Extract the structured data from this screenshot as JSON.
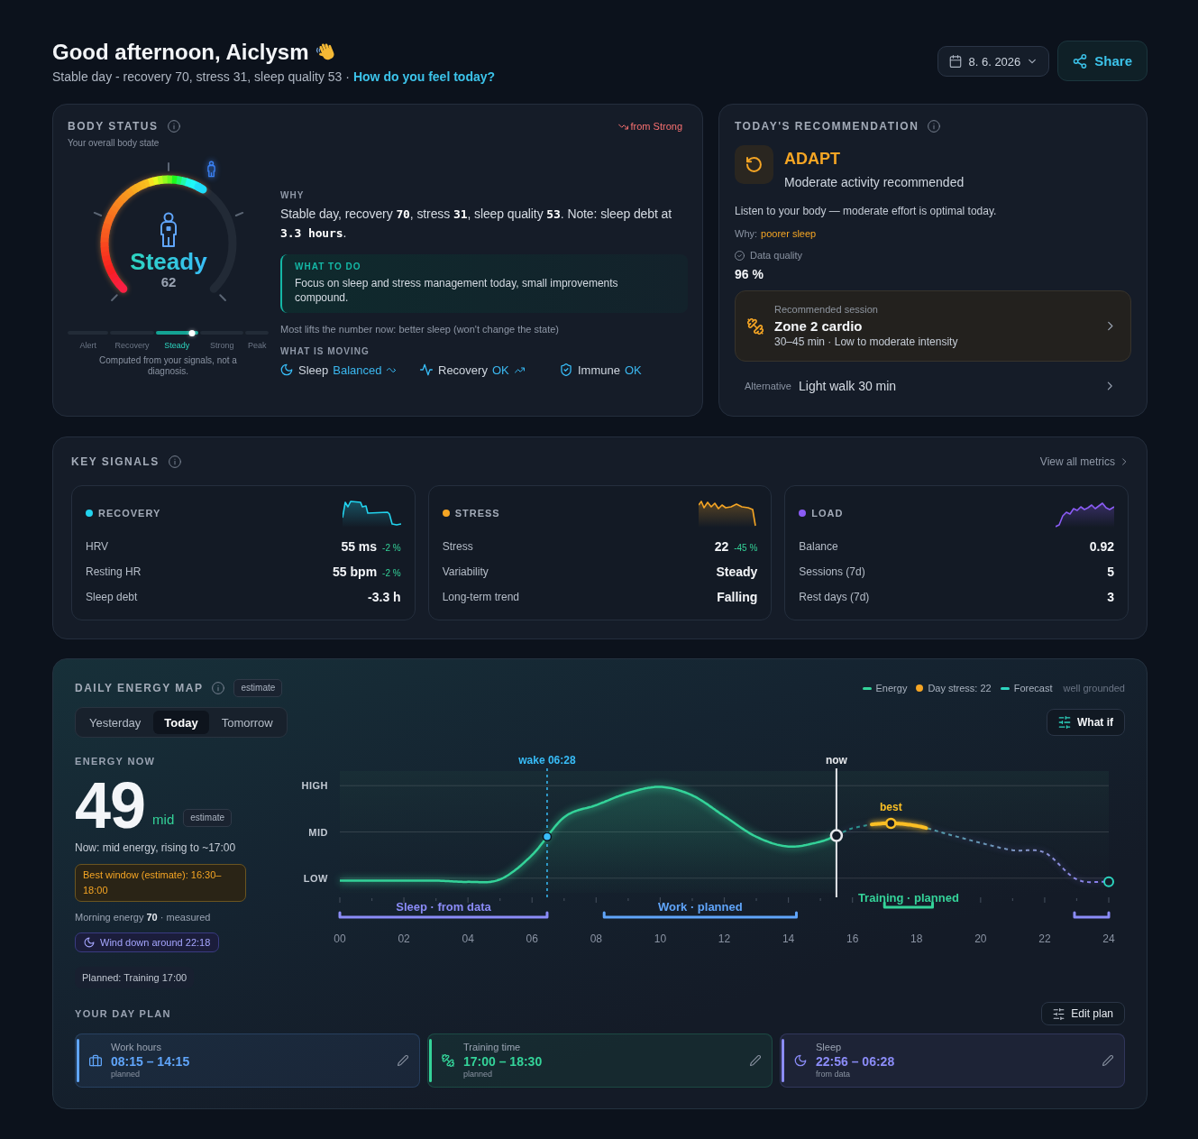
{
  "header": {
    "greeting": "Good afternoon, Aiclysm",
    "summary": "Stable day - recovery 70, stress 31, sleep quality 53 ·",
    "link": "How do you feel today?",
    "date": "8. 6. 2026",
    "share": "Share"
  },
  "body_status": {
    "title": "BODY STATUS",
    "subtitle": "Your overall body state",
    "change": {
      "label": "from Strong"
    },
    "gauge": {
      "state": "Steady",
      "score": "62",
      "level": 0.62
    },
    "scale": [
      {
        "label": "Alert",
        "selected": false
      },
      {
        "label": "Recovery",
        "selected": false
      },
      {
        "label": "Steady",
        "selected": true
      },
      {
        "label": "Strong",
        "selected": false
      },
      {
        "label": "Peak",
        "selected": false
      }
    ],
    "disclaimer": "Computed from your signals, not a diagnosis.",
    "why_title": "WHY",
    "why": "Stable day, recovery **70**, stress **31**, sleep quality **53**. Note: sleep debt at **3.3 hours**.",
    "todo": {
      "title": "WHAT TO DO",
      "text": "Focus on sleep and stress management today, small improvements compound."
    },
    "lift_note": "Most lifts the number now: better sleep (won't change the state)",
    "moving_title": "WHAT IS MOVING",
    "moving": [
      {
        "kind": "sleep",
        "label": "Sleep",
        "status": "Balanced",
        "trend": {
          "kind": "sideways"
        }
      },
      {
        "kind": "recovery",
        "label": "Recovery",
        "status": "OK",
        "trend": {
          "kind": "up"
        }
      },
      {
        "kind": "immune",
        "label": "Immune",
        "status": "OK"
      }
    ]
  },
  "recommendation": {
    "title": "TODAY'S RECOMMENDATION",
    "mode": "ADAPT",
    "headline": "Moderate activity recommended",
    "advice": "Listen to your body — moderate effort is optimal today.",
    "why_label": "Why:",
    "why_value": "poorer sleep",
    "quality_label": "Data quality",
    "quality_value": "96 %",
    "session": {
      "caption": "Recommended session",
      "name": "Zone 2 cardio",
      "details": "30–45 min · Low to moderate intensity"
    },
    "alternative": {
      "caption": "Alternative",
      "name": "Light walk 30 min"
    }
  },
  "key_signals": {
    "title": "KEY SIGNALS",
    "link": "View all metrics",
    "cards": [
      {
        "title": "RECOVERY",
        "color": "#22d3ee",
        "rows": [
          {
            "label": "HRV",
            "value": "55 ms",
            "delta": "-2 %"
          },
          {
            "label": "Resting HR",
            "value": "55 bpm",
            "delta": "-2 %"
          },
          {
            "label": "Sleep debt",
            "value": "-3.3 h"
          }
        ]
      },
      {
        "title": "STRESS",
        "color": "#f5a524",
        "rows": [
          {
            "label": "Stress",
            "value": "22",
            "delta": "-45 %"
          },
          {
            "label": "Variability",
            "value": "Steady"
          },
          {
            "label": "Long-term trend",
            "value": "Falling"
          }
        ]
      },
      {
        "title": "LOAD",
        "color": "#8b5cf6",
        "rows": [
          {
            "label": "Balance",
            "value": "0.92"
          },
          {
            "label": "Sessions (7d)",
            "value": "5"
          },
          {
            "label": "Rest days (7d)",
            "value": "3"
          }
        ]
      }
    ]
  },
  "energy_map": {
    "title": "DAILY ENERGY MAP",
    "badge": "estimate",
    "legend": [
      {
        "kind": "line",
        "label": "Energy",
        "color": "#34d399"
      },
      {
        "kind": "dot",
        "label": "Day stress: 22",
        "color": "#f5a524"
      },
      {
        "kind": "line",
        "label": "Forecast",
        "color": "#2dd4bf"
      }
    ],
    "legend_note": "well grounded",
    "tabs": [
      {
        "label": "Yesterday",
        "selected": false
      },
      {
        "label": "Today",
        "selected": true
      },
      {
        "label": "Tomorrow",
        "selected": false
      }
    ],
    "what_if": "What if",
    "now": {
      "title": "ENERGY NOW",
      "value": "49",
      "level_label": "mid",
      "badge": "estimate",
      "summary": "Now: mid energy, rising to ~17:00",
      "best_window": "Best window (estimate): 16:30–18:00",
      "morning": "Morning energy **70** · measured",
      "wind_down": "Wind down around 22:18",
      "planned": "Planned: Training 17:00"
    },
    "chart": {
      "levels": [
        "HIGH",
        "MID",
        "LOW"
      ],
      "hours": [
        "00",
        "02",
        "04",
        "06",
        "08",
        "10",
        "12",
        "14",
        "16",
        "18",
        "20",
        "22",
        "24"
      ],
      "markers": [
        {
          "label": "wake 06:28",
          "color": "#38bdf8"
        },
        {
          "label": "now",
          "color": "#e5e7eb"
        }
      ],
      "best_label": "best",
      "spans": [
        {
          "label": "Sleep · from data",
          "color": "#8b8cf8"
        },
        {
          "label": "Work · planned",
          "color": "#60a5fa"
        },
        {
          "label": "Training · planned",
          "color": "#34d399"
        },
        {
          "color": "#8b8cf8"
        }
      ]
    }
  },
  "day_plan": {
    "title": "YOUR DAY PLAN",
    "edit": "Edit plan",
    "items": [
      {
        "kind": "work",
        "label": "Work hours",
        "time": "08:15 – 14:15",
        "note": "planned",
        "color": "#60a5fa"
      },
      {
        "kind": "training",
        "label": "Training time",
        "time": "17:00 – 18:30",
        "note": "planned",
        "color": "#34d399"
      },
      {
        "kind": "sleep",
        "label": "Sleep",
        "time": "22:56 – 06:28",
        "note": "from data",
        "color": "#8b8cf8"
      }
    ]
  }
}
